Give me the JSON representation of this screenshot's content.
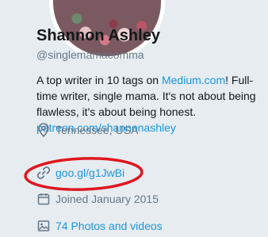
{
  "profile": {
    "name": "Shannon Ashley",
    "handle": "@singlemamacomma",
    "bio": {
      "part1": "A top writer in 10 tags on ",
      "medium_link": "Medium.com",
      "part2": "! Full-time writer, single mama. It's not about being flawless, it's about being honest. ",
      "patreon_link": "patreon.com/shannonashley"
    },
    "location": "Tennessee, USA",
    "website": "goo.gl/g1JwBi",
    "joined": "Joined January 2015",
    "photos_videos": "74 Photos and videos"
  },
  "icons": {
    "location": "map-pin-icon",
    "website": "link-icon",
    "joined": "calendar-icon",
    "photos": "image-icon"
  },
  "colors": {
    "background": "#e6ecf0",
    "text": "#14171a",
    "secondary": "#657786",
    "link": "#1b95e0",
    "annotation": "#e0161f"
  }
}
